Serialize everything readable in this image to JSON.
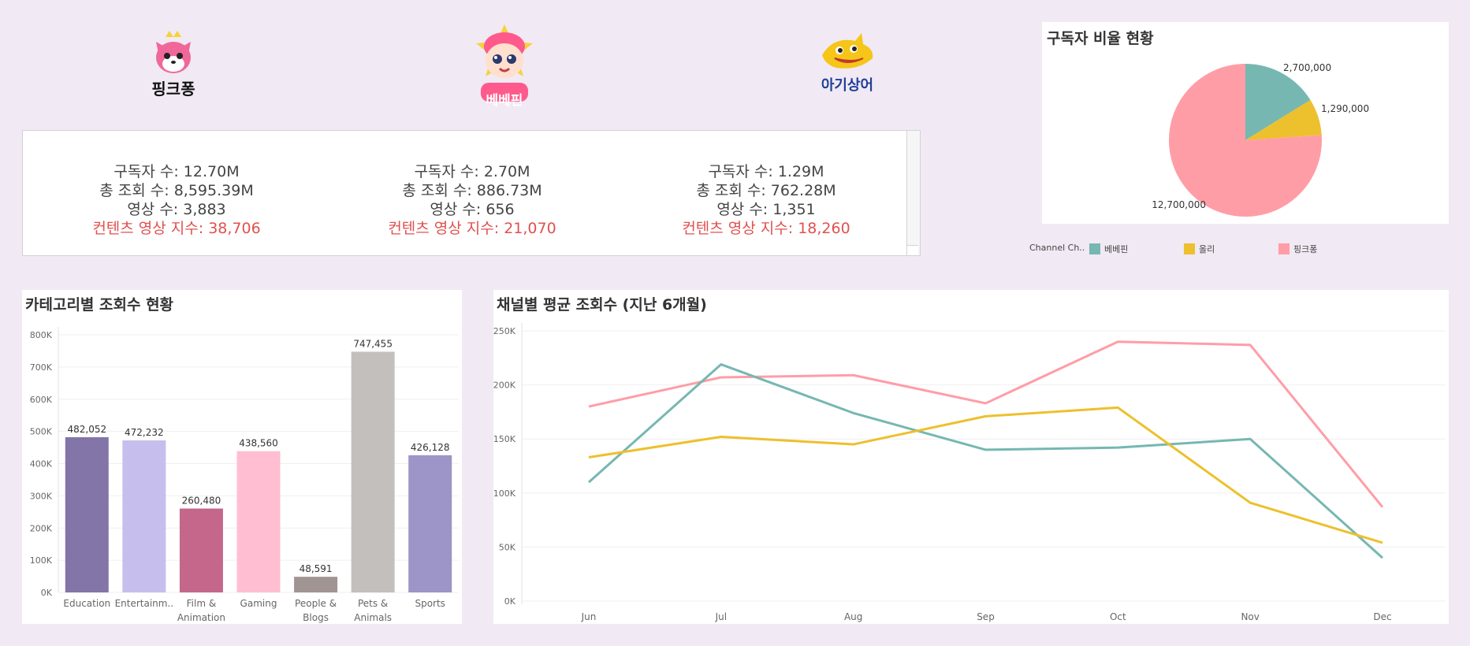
{
  "logos": [
    {
      "name": "핑크퐁",
      "icon": "pinkfong-fox-icon",
      "color": "#f0679a"
    },
    {
      "name": "베베핀",
      "icon": "bebefinn-baby-icon",
      "color": "#ff5a8c"
    },
    {
      "name": "아기상어",
      "icon": "babyshark-icon",
      "color": "#f5c518"
    }
  ],
  "channels": [
    {
      "subscribers": "구독자 수: 12.70M",
      "views": "총 조회 수: 8,595.39M",
      "videos": "영상 수: 3,883",
      "index": "컨텐츠 영상 지수: 38,706"
    },
    {
      "subscribers": "구독자 수: 2.70M",
      "views": "총 조회 수: 886.73M",
      "videos": "영상 수: 656",
      "index": "컨텐츠 영상 지수: 21,070"
    },
    {
      "subscribers": "구독자 수: 1.29M",
      "views": "총 조회 수: 762.28M",
      "videos": "영상 수: 1,351",
      "index": "컨텐츠 영상 지수: 18,260"
    }
  ],
  "pie": {
    "title": "구독자 비율 현황",
    "legend_title": "Channel Ch..",
    "chart_data": {
      "type": "pie",
      "slices": [
        {
          "label": "베베핀",
          "value": 2700000,
          "display": "2,700,000",
          "color": "#76b7b2"
        },
        {
          "label": "올리",
          "value": 1290000,
          "display": "1,290,000",
          "color": "#edc02d"
        },
        {
          "label": "핑크퐁",
          "value": 12700000,
          "display": "12,700,000",
          "color": "#ff9da7"
        }
      ]
    }
  },
  "bar": {
    "title": "카테고리별 조회수 현황",
    "chart_data": {
      "type": "bar",
      "categories": [
        [
          "Education"
        ],
        [
          "Entertainm.."
        ],
        [
          "Film &",
          "Animation"
        ],
        [
          "Gaming"
        ],
        [
          "People &",
          "Blogs"
        ],
        [
          "Pets &",
          "Animals"
        ],
        [
          "Sports"
        ]
      ],
      "values": [
        482052,
        472232,
        260480,
        438560,
        48591,
        747455,
        426128
      ],
      "labels": [
        "482,052",
        "472,232",
        "260,480",
        "438,560",
        "48,591",
        "747,455",
        "426,128"
      ],
      "colors": [
        "#8375a8",
        "#c6bfee",
        "#c4678a",
        "#ffbed2",
        "#a09593",
        "#c3bfbc",
        "#9d94c8"
      ],
      "ylim": [
        0,
        800000
      ],
      "yticks": [
        0,
        100000,
        200000,
        300000,
        400000,
        500000,
        600000,
        700000,
        800000
      ],
      "ytick_labels": [
        "0K",
        "100K",
        "200K",
        "300K",
        "400K",
        "500K",
        "600K",
        "700K",
        "800K"
      ]
    }
  },
  "line": {
    "title": "채널별 평균 조회수 (지난 6개월)",
    "chart_data": {
      "type": "line",
      "x": [
        "Jun",
        "Jul",
        "Aug",
        "Sep",
        "Oct",
        "Nov",
        "Dec"
      ],
      "ylim": [
        0,
        250000
      ],
      "yticks": [
        0,
        50000,
        100000,
        150000,
        200000,
        250000
      ],
      "ytick_labels": [
        "0K",
        "50K",
        "100K",
        "150K",
        "200K",
        "250K"
      ],
      "series": [
        {
          "name": "핑크퐁",
          "color": "#ff9da7",
          "values": [
            180000,
            207000,
            209000,
            183000,
            240000,
            237000,
            87000
          ]
        },
        {
          "name": "베베핀",
          "color": "#76b7b2",
          "values": [
            110000,
            219000,
            174000,
            140000,
            142000,
            150000,
            40000
          ]
        },
        {
          "name": "올리",
          "color": "#edc02d",
          "values": [
            133000,
            152000,
            145000,
            171000,
            179000,
            91000,
            54000
          ]
        }
      ]
    }
  }
}
